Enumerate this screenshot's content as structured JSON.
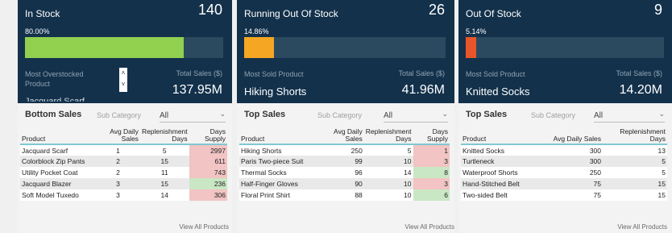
{
  "cards": [
    {
      "title": "In Stock",
      "count": "140",
      "percent_label": "80.00%",
      "bar_fraction": 0.8,
      "bar_color": "#92d050",
      "left_label_line1": "Most Overstocked",
      "left_label_line2": "Product",
      "left_value": "Jacquard Scarf",
      "right_label": "Total Sales ($)",
      "right_value": "137.95M",
      "table_title": "Bottom Sales",
      "subcategory_label": "Sub Category",
      "filter_value": "All",
      "columns": [
        "Product",
        "Avg Daily Sales",
        "Replenishment Days",
        "Days Supply"
      ],
      "rows": [
        [
          "Jacquard Scarf",
          "1",
          "5",
          "2997"
        ],
        [
          "Colorblock Zip Pants",
          "2",
          "15",
          "611"
        ],
        [
          "Utility Pocket Coat",
          "2",
          "11",
          "743"
        ],
        [
          "Jacquard Blazer",
          "3",
          "15",
          "236"
        ],
        [
          "Soft Model Tuxedo",
          "3",
          "14",
          "306"
        ]
      ],
      "view_all": "View All Products"
    },
    {
      "title": "Running Out Of Stock",
      "count": "26",
      "percent_label": "14.86%",
      "bar_fraction": 0.1486,
      "bar_color": "#f5a623",
      "left_label": "Most Sold Product",
      "left_value": "Hiking Shorts",
      "right_label": "Total Sales ($)",
      "right_value": "41.96M",
      "table_title": "Top Sales",
      "subcategory_label": "Sub Category",
      "filter_value": "All",
      "columns": [
        "Product",
        "Avg Daily Sales",
        "Replenishment Days",
        "Days Supply"
      ],
      "rows": [
        [
          "Hiking Shorts",
          "250",
          "5",
          "1"
        ],
        [
          "Paris Two-piece Suit",
          "99",
          "10",
          "3"
        ],
        [
          "Thermal Socks",
          "96",
          "14",
          "8"
        ],
        [
          "Half-Finger Gloves",
          "90",
          "10",
          "3"
        ],
        [
          "Floral Print Shirt",
          "88",
          "10",
          "6"
        ]
      ],
      "view_all": "View All Products"
    },
    {
      "title": "Out Of Stock",
      "count": "9",
      "percent_label": "5.14%",
      "bar_fraction": 0.0514,
      "bar_color": "#e8552a",
      "left_label": "Most Sold Product",
      "left_value": "Knitted Socks",
      "right_label": "Total Sales ($)",
      "right_value": "14.20M",
      "table_title": "Top Sales",
      "subcategory_label": "Sub Category",
      "filter_value": "All",
      "columns": [
        "Product",
        "Avg Daily Sales",
        "Replenishment Days"
      ],
      "rows": [
        [
          "Knitted Socks",
          "300",
          "13"
        ],
        [
          "Turtleneck",
          "300",
          "5"
        ],
        [
          "Waterproof Shorts",
          "250",
          "5"
        ],
        [
          "Hand-Stitched Belt",
          "75",
          "15"
        ],
        [
          "Two-sided Belt",
          "75",
          "15"
        ]
      ],
      "view_all": "View All Products"
    }
  ],
  "icons": {
    "scroll_up": "chevron-up-icon",
    "scroll_down": "chevron-down-icon",
    "dropdown": "chevron-down-icon"
  },
  "colors": {
    "header_bg": "#13314b",
    "bar_track": "#2c4a5f",
    "high_supply": "#f2c4c4",
    "low_supply": "#c9e7c4",
    "header_rule": "#7ec8d3"
  },
  "supply_highlight": {
    "card1": [
      "hot",
      "hot",
      "hot",
      "cool",
      "hot"
    ],
    "card2": [
      "hot",
      "hot",
      "cool",
      "hot",
      "cool"
    ]
  }
}
